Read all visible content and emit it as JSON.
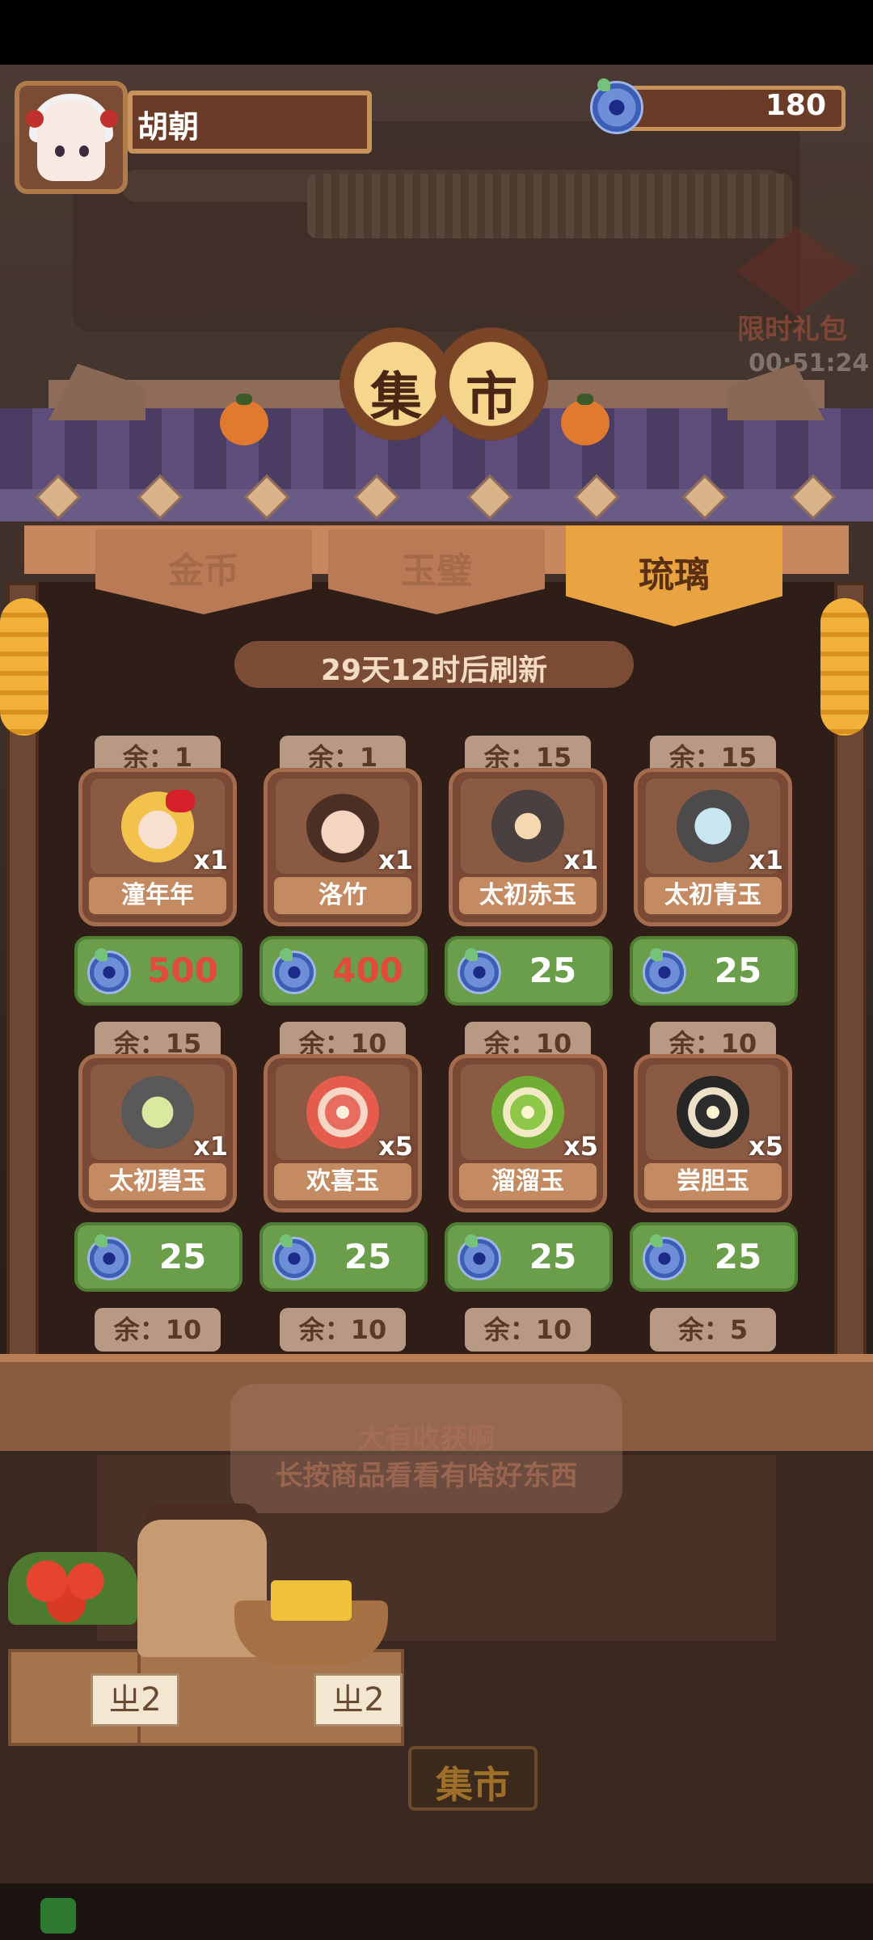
{
  "player": {
    "name": "胡朝"
  },
  "currency": {
    "amount": "180",
    "icon": "blue-jade-coin-icon",
    "color": "#3a5fb5"
  },
  "gift": {
    "label": "限时礼包",
    "timer": "00:51:24"
  },
  "sign": {
    "chars": [
      "集",
      "市"
    ]
  },
  "tabs": [
    {
      "label": "金币",
      "active": false
    },
    {
      "label": "玉璧",
      "active": false
    },
    {
      "label": "琉璃",
      "active": true
    }
  ],
  "refresh_text": "29天12时后刷新",
  "items": [
    {
      "stock": "余：1",
      "name": "潼年年",
      "qty": "x1",
      "price": "500",
      "price_color": "#e24b3a"
    },
    {
      "stock": "余：1",
      "name": "洛竹",
      "qty": "x1",
      "price": "400",
      "price_color": "#e24b3a"
    },
    {
      "stock": "余：15",
      "name": "太初赤玉",
      "qty": "x1",
      "price": "25",
      "price_color": "#ffffff"
    },
    {
      "stock": "余：15",
      "name": "太初青玉",
      "qty": "x1",
      "price": "25",
      "price_color": "#ffffff"
    },
    {
      "stock": "余：15",
      "name": "太初碧玉",
      "qty": "x1",
      "price": "25",
      "price_color": "#ffffff"
    },
    {
      "stock": "余：10",
      "name": "欢喜玉",
      "qty": "x5",
      "price": "25",
      "price_color": "#ffffff"
    },
    {
      "stock": "余：10",
      "name": "溜溜玉",
      "qty": "x5",
      "price": "25",
      "price_color": "#ffffff"
    },
    {
      "stock": "余：10",
      "name": "尝胆玉",
      "qty": "x5",
      "price": "25",
      "price_color": "#ffffff"
    }
  ],
  "next_row_stock": [
    "余：10",
    "余：10",
    "余：10",
    "余：5"
  ],
  "tip": {
    "line1": "大有收获啊",
    "line2": "长按商品看看有啥好东西"
  },
  "price_tags": [
    "ㄓ2",
    "ㄓ2"
  ],
  "market_sign": "集市",
  "colors": {
    "price_button": "#6a9e4a",
    "active_tab": "#e9a340",
    "roof": "#4b3c63"
  }
}
